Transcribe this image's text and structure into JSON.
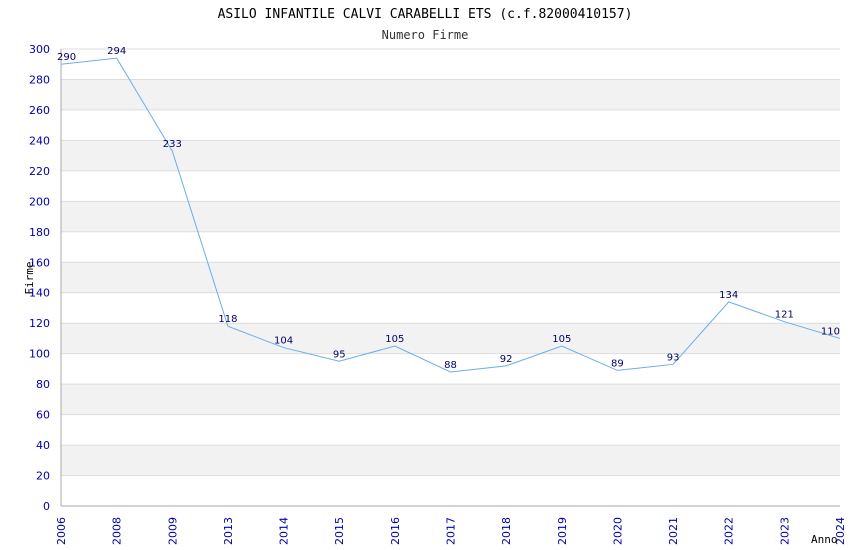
{
  "chart_data": {
    "type": "line",
    "title": "ASILO INFANTILE CALVI CARABELLI ETS (c.f.82000410157)",
    "subtitle": "Numero Firme",
    "xlabel": "Anno",
    "ylabel": "Firme",
    "categories": [
      "2006",
      "2008",
      "2009",
      "2013",
      "2014",
      "2015",
      "2016",
      "2017",
      "2018",
      "2019",
      "2020",
      "2021",
      "2022",
      "2023",
      "2024"
    ],
    "series": [
      {
        "values": [
          290,
          294,
          233,
          118,
          104,
          95,
          105,
          88,
          92,
          105,
          89,
          93,
          134,
          121,
          110
        ]
      }
    ],
    "ylim": [
      0,
      300
    ],
    "yticks": [
      0,
      20,
      40,
      60,
      80,
      100,
      120,
      140,
      160,
      180,
      200,
      220,
      240,
      260,
      280,
      300
    ],
    "grid": true,
    "colors": {
      "line": "#6aaee8",
      "band": "#f2f2f2",
      "gridline": "#dddddd",
      "axis": "#aaaaaa",
      "tick_text": "#0000aa",
      "label_text": "#000066"
    }
  }
}
